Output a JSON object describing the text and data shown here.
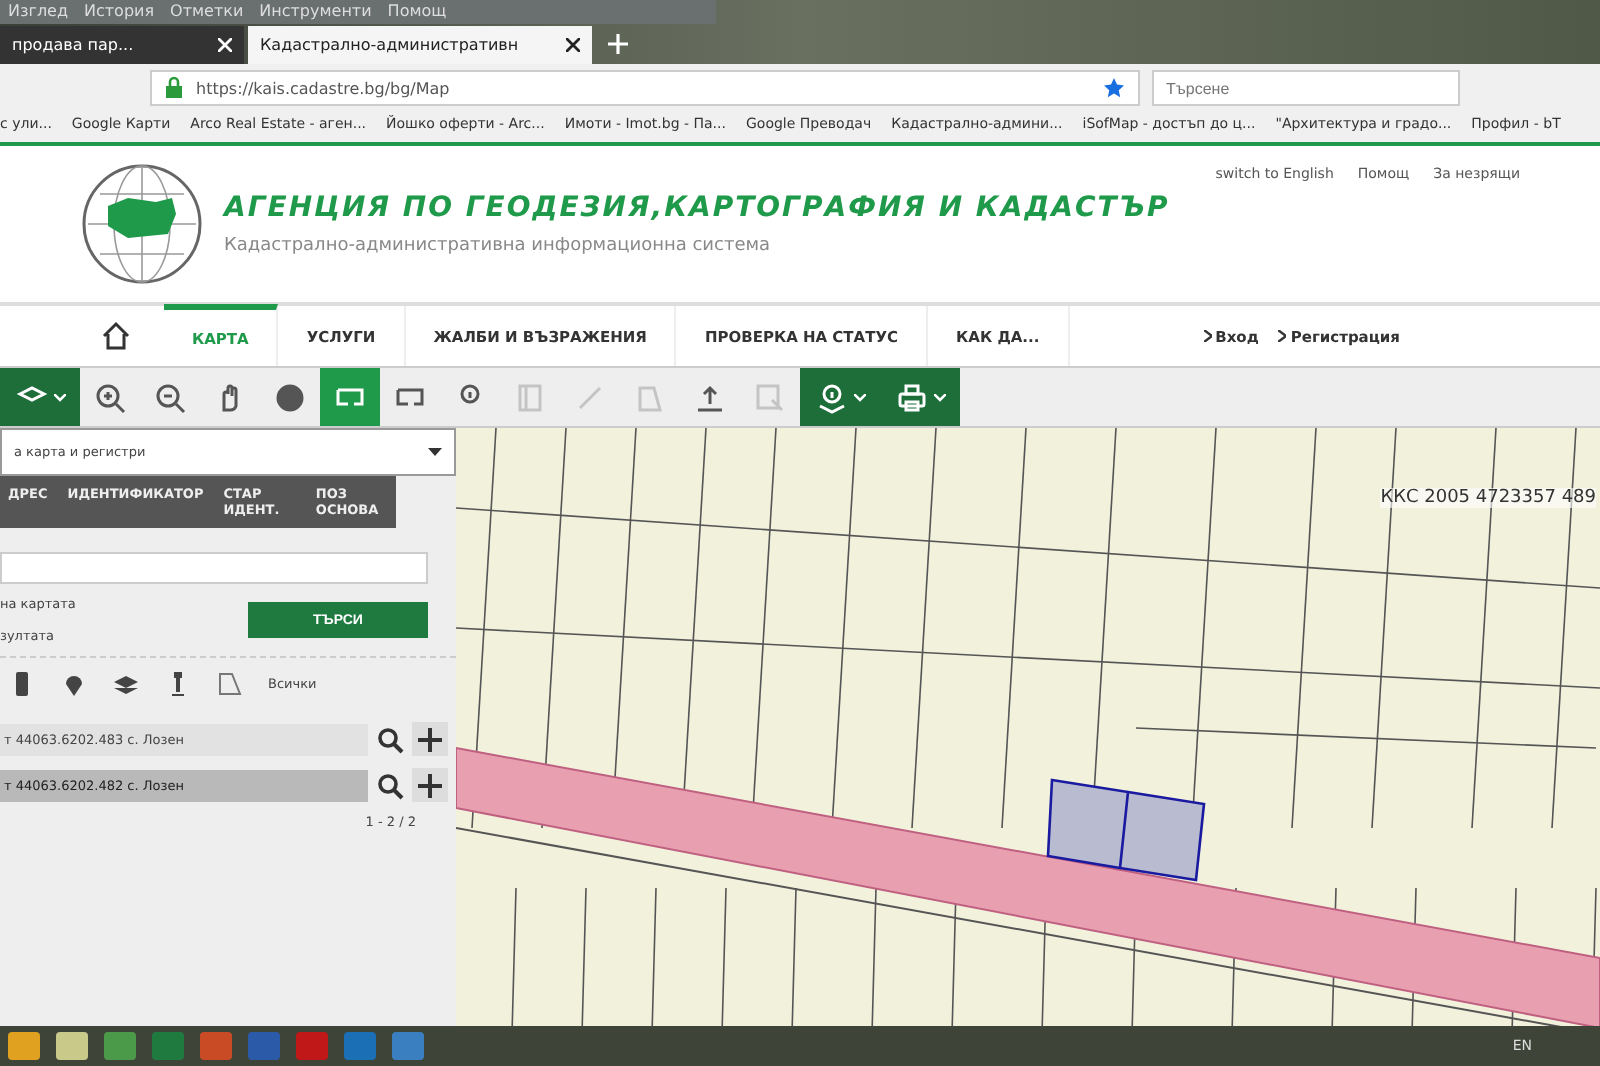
{
  "browser": {
    "menu": [
      "Изглед",
      "История",
      "Отметки",
      "Инструменти",
      "Помощ"
    ],
    "tabs": [
      {
        "label": "продава пар...",
        "selected": false
      },
      {
        "label": "Кадастрално-административн",
        "selected": true
      }
    ],
    "url": "https://kais.cadastre.bg/bg/Map",
    "search": {
      "placeholder": "Търсене"
    },
    "bookmarks": [
      "с ули...",
      "Google Карти",
      "Arco Real Estate - аген...",
      "Йошко оферти - Arc...",
      "Имоти - Imot.bg - Па...",
      "Google Преводач",
      "Кадастрално-админи...",
      "iSofMap - достъп до ц...",
      "\"Архитектура и градо...",
      "Профил - bT"
    ]
  },
  "header": {
    "title": "АГЕНЦИЯ ПО ГЕОДЕЗИЯ,КАРТОГРАФИЯ И КАДАСТЪР",
    "subtitle": "Кадастрално-административна информационна система",
    "links": [
      "switch to English",
      "Помощ",
      "За незрящи"
    ]
  },
  "nav": {
    "items": [
      {
        "label": "КАРТА",
        "selected": true
      },
      {
        "label": "УСЛУГИ",
        "selected": false
      },
      {
        "label": "ЖАЛБИ И ВЪЗРАЖЕНИЯ",
        "selected": false
      },
      {
        "label": "ПРОВЕРКА НА СТАТУС",
        "selected": false
      },
      {
        "label": "КАК ДА...",
        "selected": false
      }
    ],
    "account": [
      "Вход",
      "Регистрация"
    ]
  },
  "toolbar": [
    {
      "kind": "layers",
      "dropdown": true,
      "selected": false,
      "disabled": false
    },
    {
      "kind": "zoom-in",
      "dropdown": false,
      "selected": false,
      "disabled": false
    },
    {
      "kind": "zoom-out",
      "dropdown": false,
      "selected": false,
      "disabled": false
    },
    {
      "kind": "hand",
      "dropdown": false,
      "selected": false,
      "disabled": false
    },
    {
      "kind": "globe",
      "dropdown": false,
      "selected": false,
      "disabled": false
    },
    {
      "kind": "rect",
      "dropdown": false,
      "selected": true,
      "disabled": false
    },
    {
      "kind": "rect",
      "dropdown": false,
      "selected": false,
      "disabled": false
    },
    {
      "kind": "info",
      "dropdown": false,
      "selected": false,
      "disabled": false
    },
    {
      "kind": "report",
      "dropdown": false,
      "selected": false,
      "disabled": true
    },
    {
      "kind": "ruler",
      "dropdown": false,
      "selected": false,
      "disabled": true
    },
    {
      "kind": "polygon",
      "dropdown": false,
      "selected": false,
      "disabled": true
    },
    {
      "kind": "upload",
      "dropdown": false,
      "selected": false,
      "disabled": false
    },
    {
      "kind": "select",
      "dropdown": false,
      "selected": false,
      "disabled": true
    },
    {
      "kind": "info-layers",
      "dropdown": true,
      "selected": false,
      "disabled": false
    },
    {
      "kind": "print",
      "dropdown": true,
      "selected": false,
      "disabled": false
    }
  ],
  "panel": {
    "source": "а карта и регистри",
    "tabs": [
      "ДРЕС",
      "ИДЕНТИФИКАТОР",
      "СТАР ИДЕНТ.",
      "ПОЗ ОСНОВА"
    ],
    "options": [
      "на картата",
      "зултата"
    ],
    "search_button": "ТЪРСИ",
    "filters": [
      {
        "kind": "building"
      },
      {
        "kind": "pin"
      },
      {
        "kind": "layers"
      },
      {
        "kind": "marker"
      },
      {
        "kind": "polygon"
      }
    ],
    "filter_all": "Всички",
    "results": [
      {
        "label": "т 44063.6202.483 с. Лозен",
        "selected": false
      },
      {
        "label": "т 44063.6202.482 с. Лозен",
        "selected": true
      }
    ],
    "pagination": "1 - 2 / 2"
  },
  "map": {
    "coordinates": "ККС 2005 4723357 489"
  },
  "taskbar": {
    "apps": [
      {
        "color": "#e0a020"
      },
      {
        "color": "#c9c98a"
      },
      {
        "color": "#4a9a4a"
      },
      {
        "color": "#1f7a3f"
      },
      {
        "color": "#c84b25"
      },
      {
        "color": "#2b5aa8"
      },
      {
        "color": "#c01818"
      },
      {
        "color": "#1a6fb5"
      },
      {
        "color": "#3a80c0"
      }
    ],
    "language": "EN"
  }
}
